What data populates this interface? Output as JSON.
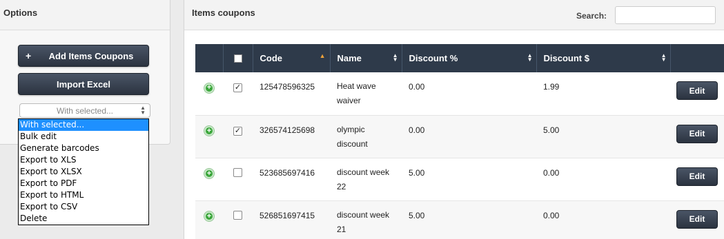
{
  "options": {
    "title": "Options",
    "add_button": "Add Items Coupons",
    "add_button_icon": "+",
    "import_button": "Import Excel",
    "bulk_select": {
      "value": "With selected...",
      "options": [
        "With selected...",
        "Bulk edit",
        "Generate barcodes",
        "Export to XLS",
        "Export to XLSX",
        "Export to PDF",
        "Export to HTML",
        "Export to CSV",
        "Delete"
      ]
    }
  },
  "main": {
    "title": "Items coupons",
    "search_label": "Search:",
    "search_value": ""
  },
  "table": {
    "headers": [
      "",
      "",
      "Code",
      "Name",
      "Discount %",
      "Discount $",
      ""
    ],
    "edit_label": "Edit",
    "rows": [
      {
        "checked": true,
        "check_mark": "✓",
        "code": "125478596325",
        "name_1": "Heat wave",
        "name_2": "waiver",
        "pct": "0.00",
        "usd": "1.99"
      },
      {
        "checked": true,
        "check_mark": "✓",
        "code": "326574125698",
        "name_1": "olympic",
        "name_2": "discount",
        "pct": "0.00",
        "usd": "5.00"
      },
      {
        "checked": false,
        "check_mark": "",
        "code": "523685697416",
        "name_1": "discount week",
        "name_2": "22",
        "pct": "5.00",
        "usd": "0.00"
      },
      {
        "checked": false,
        "check_mark": "",
        "code": "526851697415",
        "name_1": "discount week",
        "name_2": "21",
        "pct": "5.00",
        "usd": "0.00"
      }
    ]
  },
  "colors": {
    "header_bg": "#2e3a4a",
    "button_bg": "#2b3340",
    "selected_option": "#1e90ff",
    "sort_active": "#f0a23a",
    "add_icon": "#3aa63a"
  },
  "icons": {
    "add_row": "plus-circle-icon",
    "sort": "sort-arrows-icon",
    "sort_asc": "sort-ascending-icon"
  }
}
